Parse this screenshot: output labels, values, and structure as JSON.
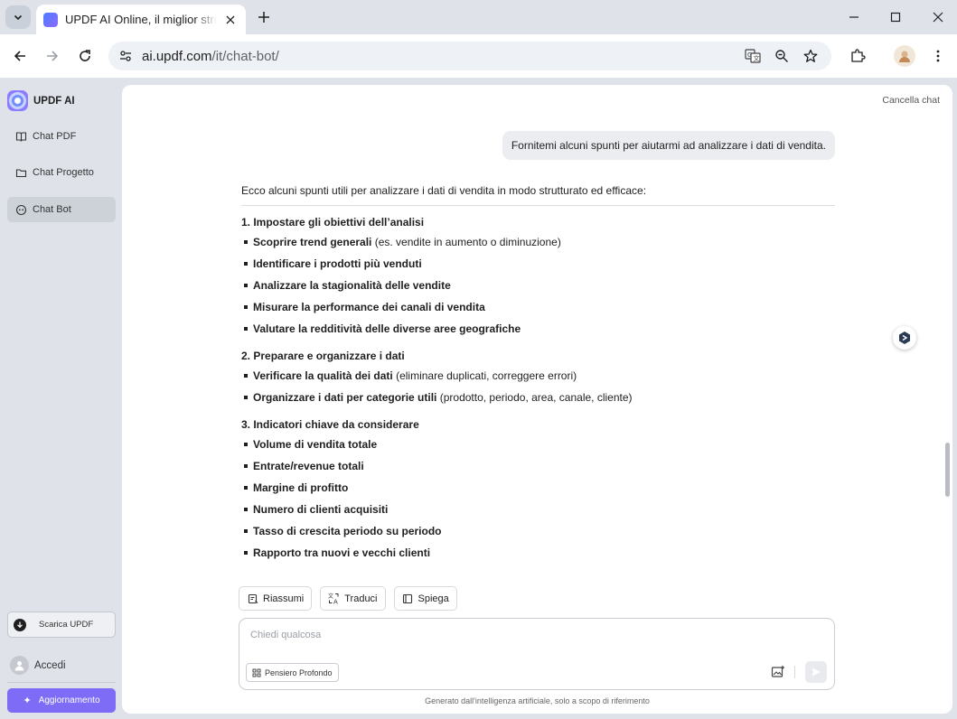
{
  "browser": {
    "tab_title": "UPDF AI Online, il miglior strumento",
    "url_host": "ai.updf.com",
    "url_path": "/it/chat-bot/"
  },
  "sidebar": {
    "brand": "UPDF AI",
    "items": [
      {
        "label": "Chat PDF",
        "icon": "book-icon"
      },
      {
        "label": "Chat Progetto",
        "icon": "folder-icon"
      },
      {
        "label": "Chat Bot",
        "icon": "bot-icon",
        "active": true
      }
    ],
    "download_label": "Scarica UPDF",
    "login_label": "Accedi",
    "upgrade_label": "Aggiornamento"
  },
  "chat": {
    "clear_label": "Cancella chat",
    "user_message": "Fornitemi alcuni spunti per aiutarmi ad analizzare i dati di vendita.",
    "answer": {
      "intro": "Ecco alcuni spunti utili per analizzare i dati di vendita in modo strutturato ed efficace:",
      "sections": [
        {
          "heading": "1. Impostare gli obiettivi dell’analisi",
          "bullets": [
            {
              "bold": "Scoprire trend generali",
              "rest": " (es. vendite in aumento o diminuzione)"
            },
            {
              "bold": "Identificare i prodotti più venduti",
              "rest": ""
            },
            {
              "bold": "Analizzare la stagionalità delle vendite",
              "rest": ""
            },
            {
              "bold": "Misurare la performance dei canali di vendita",
              "rest": ""
            },
            {
              "bold": "Valutare la redditività delle diverse aree geografiche",
              "rest": ""
            }
          ]
        },
        {
          "heading": "2. Preparare e organizzare i dati",
          "bullets": [
            {
              "bold": "Verificare la qualità dei dati",
              "rest": " (eliminare duplicati, correggere errori)"
            },
            {
              "bold": "Organizzare i dati per categorie utili",
              "rest": " (prodotto, periodo, area, canale, cliente)"
            }
          ]
        },
        {
          "heading": "3. Indicatori chiave da considerare",
          "bullets": [
            {
              "bold": "Volume di vendita totale",
              "rest": ""
            },
            {
              "bold": "Entrate/revenue totali",
              "rest": ""
            },
            {
              "bold": "Margine di profitto",
              "rest": ""
            },
            {
              "bold": "Numero di clienti acquisiti",
              "rest": ""
            },
            {
              "bold": "Tasso di crescita periodo su periodo",
              "rest": ""
            },
            {
              "bold": "Rapporto tra nuovi e vecchi clienti",
              "rest": ""
            }
          ]
        }
      ]
    },
    "quick_actions": [
      {
        "label": "Riassumi",
        "icon": "summary-icon"
      },
      {
        "label": "Traduci",
        "icon": "translate-icon"
      },
      {
        "label": "Spiega",
        "icon": "explain-icon"
      }
    ],
    "input_placeholder": "Chiedi qualcosa",
    "deep_think_label": "Pensiero Profondo",
    "footnote": "Generato dall'intelligenza artificiale, solo a scopo di riferimento"
  },
  "colors": {
    "accent": "#7f6cf6",
    "chrome_bg": "#dfe3e9",
    "bubble_bg": "#ebedf0"
  }
}
